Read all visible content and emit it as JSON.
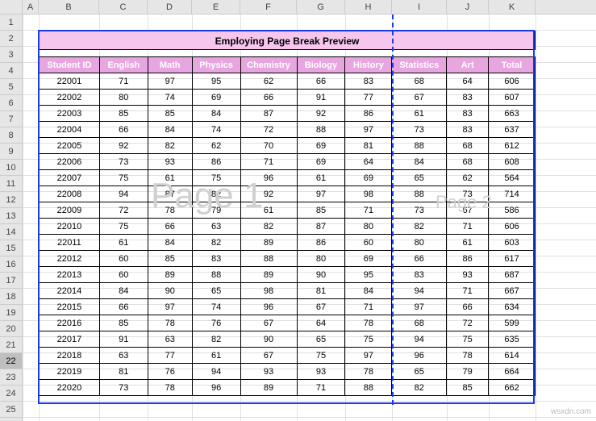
{
  "columns": {
    "labels": [
      "A",
      "B",
      "C",
      "D",
      "E",
      "F",
      "G",
      "H",
      "I",
      "J",
      "K"
    ],
    "widths": [
      20,
      75,
      60,
      55,
      60,
      70,
      60,
      58,
      68,
      52,
      58
    ]
  },
  "rows": {
    "start": 1,
    "end": 25,
    "selected": 22,
    "height": 20
  },
  "title": "Employing Page Break Preview",
  "headers": [
    "Student ID",
    "English",
    "Math",
    "Physics",
    "Chemistry",
    "Biology",
    "History",
    "Statistics",
    "Art",
    "Total"
  ],
  "chart_data": {
    "type": "table",
    "columns": [
      "Student ID",
      "English",
      "Math",
      "Physics",
      "Chemistry",
      "Biology",
      "History",
      "Statistics",
      "Art",
      "Total"
    ],
    "rows": [
      [
        22001,
        71,
        97,
        95,
        62,
        66,
        83,
        68,
        64,
        606
      ],
      [
        22002,
        80,
        74,
        69,
        66,
        91,
        77,
        67,
        83,
        607
      ],
      [
        22003,
        85,
        85,
        84,
        87,
        92,
        86,
        61,
        83,
        663
      ],
      [
        22004,
        66,
        84,
        74,
        72,
        88,
        97,
        73,
        83,
        637
      ],
      [
        22005,
        92,
        82,
        62,
        70,
        69,
        81,
        88,
        68,
        612
      ],
      [
        22006,
        73,
        93,
        86,
        71,
        69,
        64,
        84,
        68,
        608
      ],
      [
        22007,
        75,
        61,
        75,
        96,
        61,
        69,
        65,
        62,
        564
      ],
      [
        22008,
        94,
        87,
        82,
        92,
        97,
        98,
        88,
        73,
        714
      ],
      [
        22009,
        72,
        78,
        79,
        61,
        85,
        71,
        73,
        67,
        586
      ],
      [
        22010,
        75,
        66,
        63,
        82,
        87,
        80,
        82,
        71,
        606
      ],
      [
        22011,
        61,
        84,
        82,
        89,
        86,
        60,
        80,
        61,
        603
      ],
      [
        22012,
        60,
        85,
        83,
        88,
        80,
        69,
        66,
        86,
        617
      ],
      [
        22013,
        60,
        89,
        88,
        89,
        90,
        95,
        83,
        93,
        687
      ],
      [
        22014,
        84,
        90,
        65,
        98,
        81,
        84,
        94,
        71,
        667
      ],
      [
        22015,
        66,
        97,
        74,
        96,
        67,
        71,
        97,
        66,
        634
      ],
      [
        22016,
        85,
        78,
        76,
        67,
        64,
        78,
        68,
        72,
        599
      ],
      [
        22017,
        91,
        63,
        82,
        90,
        65,
        75,
        94,
        75,
        635
      ],
      [
        22018,
        63,
        77,
        61,
        67,
        75,
        97,
        96,
        78,
        614
      ],
      [
        22019,
        81,
        76,
        94,
        93,
        93,
        78,
        65,
        79,
        664
      ],
      [
        22020,
        73,
        78,
        96,
        89,
        71,
        88,
        82,
        85,
        662
      ]
    ]
  },
  "watermarks": {
    "page1": "Page 1",
    "page2": "Page 2"
  },
  "attribution": "wsxdn.com",
  "pagebreak_after_col": 8
}
